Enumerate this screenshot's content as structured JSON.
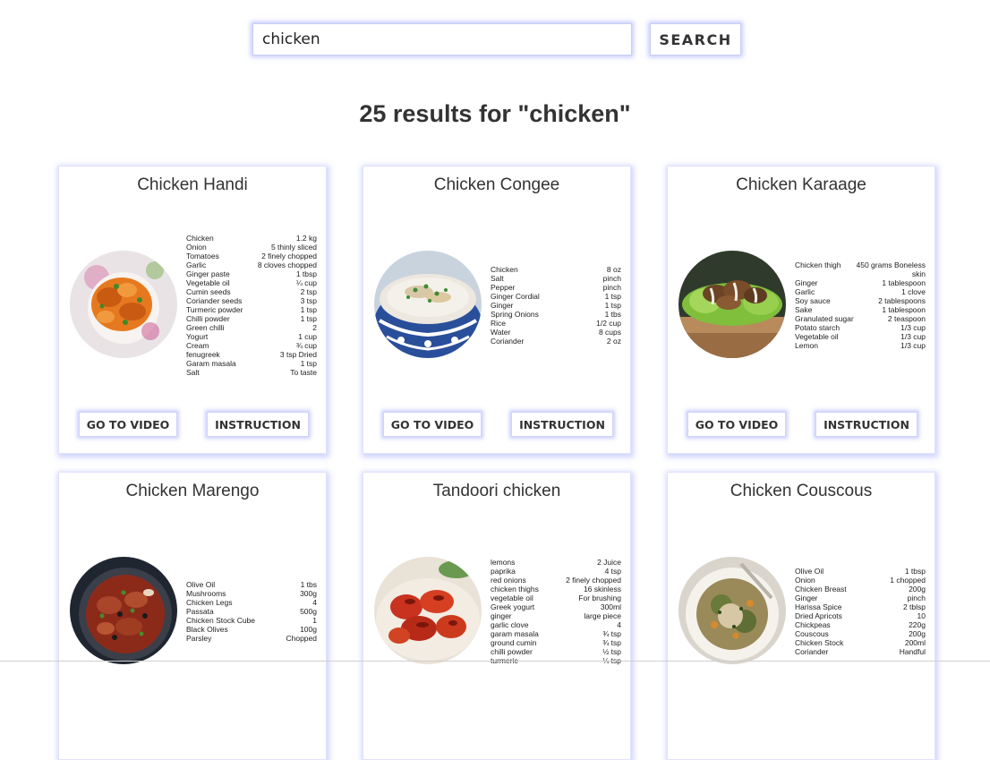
{
  "search": {
    "value": "chicken",
    "button_label": "SEARCH"
  },
  "results_heading": "25 results for \"chicken\"",
  "card_buttons": {
    "video": "GO TO VIDEO",
    "instruction": "INSTRUCTION"
  },
  "recipes": [
    {
      "title": "Chicken Handi",
      "image_icon": "curry-dish-image",
      "ingredients": [
        {
          "name": "Chicken",
          "amount": "1.2 kg"
        },
        {
          "name": "Onion",
          "amount": "5 thinly sliced"
        },
        {
          "name": "Tomatoes",
          "amount": "2 finely chopped"
        },
        {
          "name": "Garlic",
          "amount": "8 cloves chopped"
        },
        {
          "name": "Ginger paste",
          "amount": "1 tbsp"
        },
        {
          "name": "Vegetable oil",
          "amount": "¼ cup"
        },
        {
          "name": "Cumin seeds",
          "amount": "2 tsp"
        },
        {
          "name": "Coriander seeds",
          "amount": "3 tsp"
        },
        {
          "name": "Turmeric powder",
          "amount": "1 tsp"
        },
        {
          "name": "Chilli powder",
          "amount": "1 tsp"
        },
        {
          "name": "Green chilli",
          "amount": "2"
        },
        {
          "name": "Yogurt",
          "amount": "1 cup"
        },
        {
          "name": "Cream",
          "amount": "¾ cup"
        },
        {
          "name": "fenugreek",
          "amount": "3 tsp Dried"
        },
        {
          "name": "Garam masala",
          "amount": "1 tsp"
        },
        {
          "name": "Salt",
          "amount": "To taste"
        }
      ]
    },
    {
      "title": "Chicken Congee",
      "image_icon": "congee-bowl-image",
      "ingredients": [
        {
          "name": "Chicken",
          "amount": "8 oz"
        },
        {
          "name": "Salt",
          "amount": "pinch"
        },
        {
          "name": "Pepper",
          "amount": "pinch"
        },
        {
          "name": "Ginger Cordial",
          "amount": "1 tsp"
        },
        {
          "name": "Ginger",
          "amount": "1 tsp"
        },
        {
          "name": "Spring Onions",
          "amount": "1 tbs"
        },
        {
          "name": "Rice",
          "amount": "1/2 cup"
        },
        {
          "name": "Water",
          "amount": "8 cups"
        },
        {
          "name": "Coriander",
          "amount": "2 oz"
        }
      ]
    },
    {
      "title": "Chicken Karaage",
      "image_icon": "karaage-plate-image",
      "ingredients": [
        {
          "name": "Chicken thigh",
          "amount": "450 grams Boneless skin"
        },
        {
          "name": "Ginger",
          "amount": "1 tablespoon"
        },
        {
          "name": "Garlic",
          "amount": "1 clove"
        },
        {
          "name": "Soy sauce",
          "amount": "2 tablespoons"
        },
        {
          "name": "Sake",
          "amount": "1 tablespoon"
        },
        {
          "name": "Granulated sugar",
          "amount": "2 teaspoon"
        },
        {
          "name": "Potato starch",
          "amount": "1/3 cup"
        },
        {
          "name": "Vegetable oil",
          "amount": "1/3 cup"
        },
        {
          "name": "Lemon",
          "amount": "1/3 cup"
        }
      ]
    },
    {
      "title": "Chicken Marengo",
      "image_icon": "marengo-pot-image",
      "ingredients": [
        {
          "name": "Olive Oil",
          "amount": "1 tbs"
        },
        {
          "name": "Mushrooms",
          "amount": "300g"
        },
        {
          "name": "Chicken Legs",
          "amount": "4"
        },
        {
          "name": "Passata",
          "amount": "500g"
        },
        {
          "name": "Chicken Stock Cube",
          "amount": "1"
        },
        {
          "name": "Black Olives",
          "amount": "100g"
        },
        {
          "name": "Parsley",
          "amount": "Chopped"
        }
      ]
    },
    {
      "title": "Tandoori chicken",
      "image_icon": "tandoori-image",
      "ingredients": [
        {
          "name": "lemons",
          "amount": "2 Juice"
        },
        {
          "name": "paprika",
          "amount": "4 tsp"
        },
        {
          "name": "red onions",
          "amount": "2 finely chopped"
        },
        {
          "name": "chicken thighs",
          "amount": "16 skinless"
        },
        {
          "name": "vegetable oil",
          "amount": "For brushing"
        },
        {
          "name": "Greek yogurt",
          "amount": "300ml"
        },
        {
          "name": "ginger",
          "amount": "large piece"
        },
        {
          "name": "garlic clove",
          "amount": "4"
        },
        {
          "name": "garam masala",
          "amount": "¾ tsp"
        },
        {
          "name": "ground cumin",
          "amount": "¾ tsp"
        },
        {
          "name": "chilli powder",
          "amount": "½ tsp"
        },
        {
          "name": "turmeric",
          "amount": "¼ tsp"
        }
      ]
    },
    {
      "title": "Chicken Couscous",
      "image_icon": "couscous-bowl-image",
      "ingredients": [
        {
          "name": "Olive Oil",
          "amount": "1 tbsp"
        },
        {
          "name": "Onion",
          "amount": "1 chopped"
        },
        {
          "name": "Chicken Breast",
          "amount": "200g"
        },
        {
          "name": "Ginger",
          "amount": "pinch"
        },
        {
          "name": "Harissa Spice",
          "amount": "2 tblsp"
        },
        {
          "name": "Dried Apricots",
          "amount": "10"
        },
        {
          "name": "Chickpeas",
          "amount": "220g"
        },
        {
          "name": "Couscous",
          "amount": "200g"
        },
        {
          "name": "Chicken Stock",
          "amount": "200ml"
        },
        {
          "name": "Coriander",
          "amount": "Handful"
        }
      ]
    }
  ]
}
